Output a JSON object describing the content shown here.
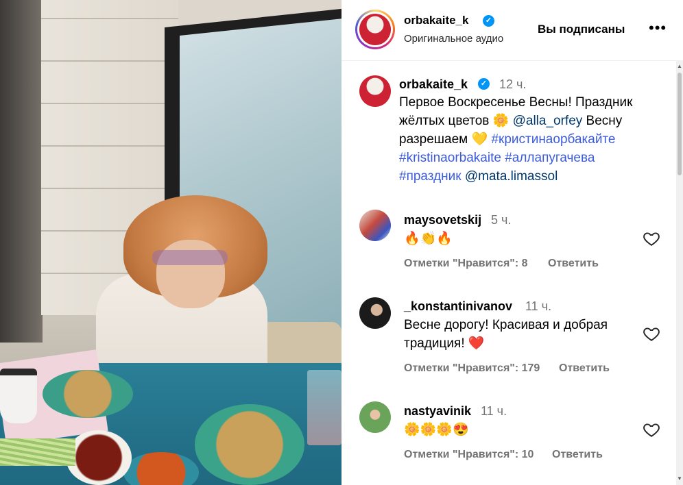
{
  "header": {
    "username": "orbakaite_k",
    "subtitle": "Оригинальное аудио",
    "follow_status": "Вы подписаны",
    "more_label": "•••"
  },
  "post": {
    "username": "orbakaite_k",
    "time": "12 ч.",
    "text_1": "Первое Воскресенье Весны! Праздник жёлтых цветов ",
    "emoji_flower": "🌼",
    "mention_alla": "@alla_orfey",
    "text_2": " Весну разрешаем ",
    "emoji_heart_yellow": "💛",
    "hashtag_1": "#кристинаорбакайте",
    "hashtag_2": "#kristinaorbakaite",
    "hashtag_3": "#аллапугачева",
    "hashtag_4": "#праздник",
    "mention_mata": "@mata.limassol"
  },
  "comments": [
    {
      "username": "maysovetskij",
      "time": "5 ч.",
      "text": "🔥👏🔥",
      "likes": "Отметки \"Нравится\": 8",
      "reply": "Ответить"
    },
    {
      "username": "_konstantinivanov",
      "time": "11 ч.",
      "text": "Весне дорогу! Красивая и добрая традиция! ❤️",
      "likes": "Отметки \"Нравится\": 179",
      "reply": "Ответить"
    },
    {
      "username": "nastyavinik",
      "time": "11 ч.",
      "text": "🌼🌼🌼😍",
      "likes": "Отметки \"Нравится\": 10",
      "reply": "Ответить"
    }
  ],
  "colors": {
    "verified": "#0095f6",
    "link": "#00376b",
    "hashtag": "#3b5bdb",
    "muted": "#737373"
  },
  "icons": [
    "verified-badge-icon",
    "more-options-icon",
    "heart-icon",
    "avatar"
  ]
}
